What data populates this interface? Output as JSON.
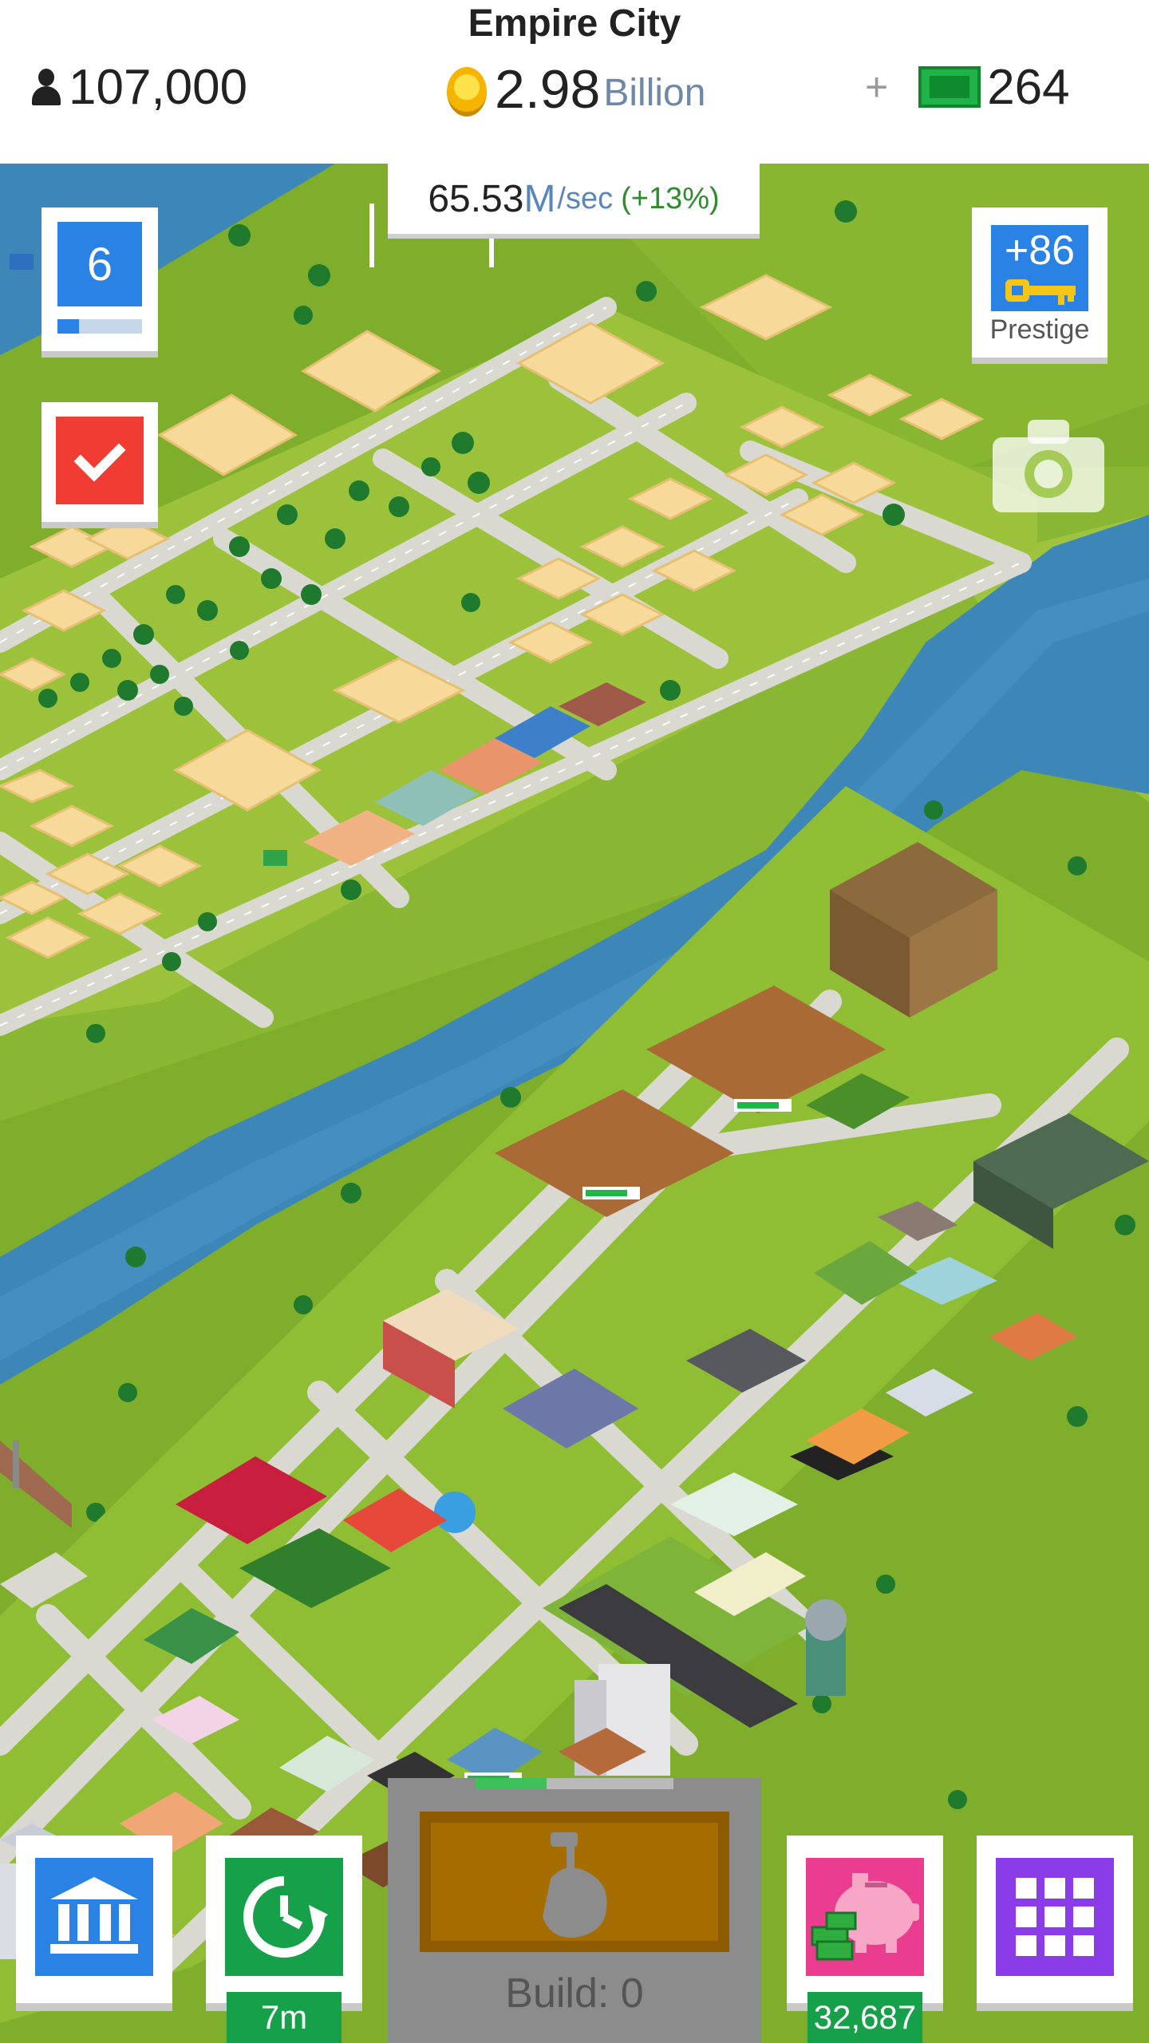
{
  "header": {
    "city_name": "Empire City",
    "population": "107,000",
    "money_value": "2.98",
    "money_unit": "Billion",
    "plus_sign": "+",
    "cash_value": "264"
  },
  "income": {
    "value": "65.53",
    "unit": "M",
    "suffix": "/sec",
    "bonus": "(+13%)"
  },
  "level": {
    "number": "6",
    "progress": 0.25
  },
  "prestige": {
    "value": "+86",
    "label": "Prestige"
  },
  "bottom": {
    "timer_label": "7m",
    "piggy_label": "32,687",
    "build_label": "Build: 0",
    "build_progress": 0.36
  },
  "icons": {
    "population": "person-icon",
    "money": "coin-icon",
    "cash": "cash-icon",
    "tasks": "check-icon",
    "prestige": "key-icon",
    "camera": "camera-icon",
    "bank": "bank-icon",
    "timer": "clock-refresh-icon",
    "build": "hammer-hand-icon",
    "piggy": "piggy-bank-icon",
    "menu": "grid-icon"
  },
  "colors": {
    "grass": "#7fae2c",
    "river": "#3d86b8",
    "road": "#d9d9d2",
    "lot": "#f7d99a",
    "blue_accent": "#2a82e4",
    "green_accent": "#16a04a",
    "red_accent": "#f03c32",
    "purple_accent": "#8a3ce6"
  }
}
